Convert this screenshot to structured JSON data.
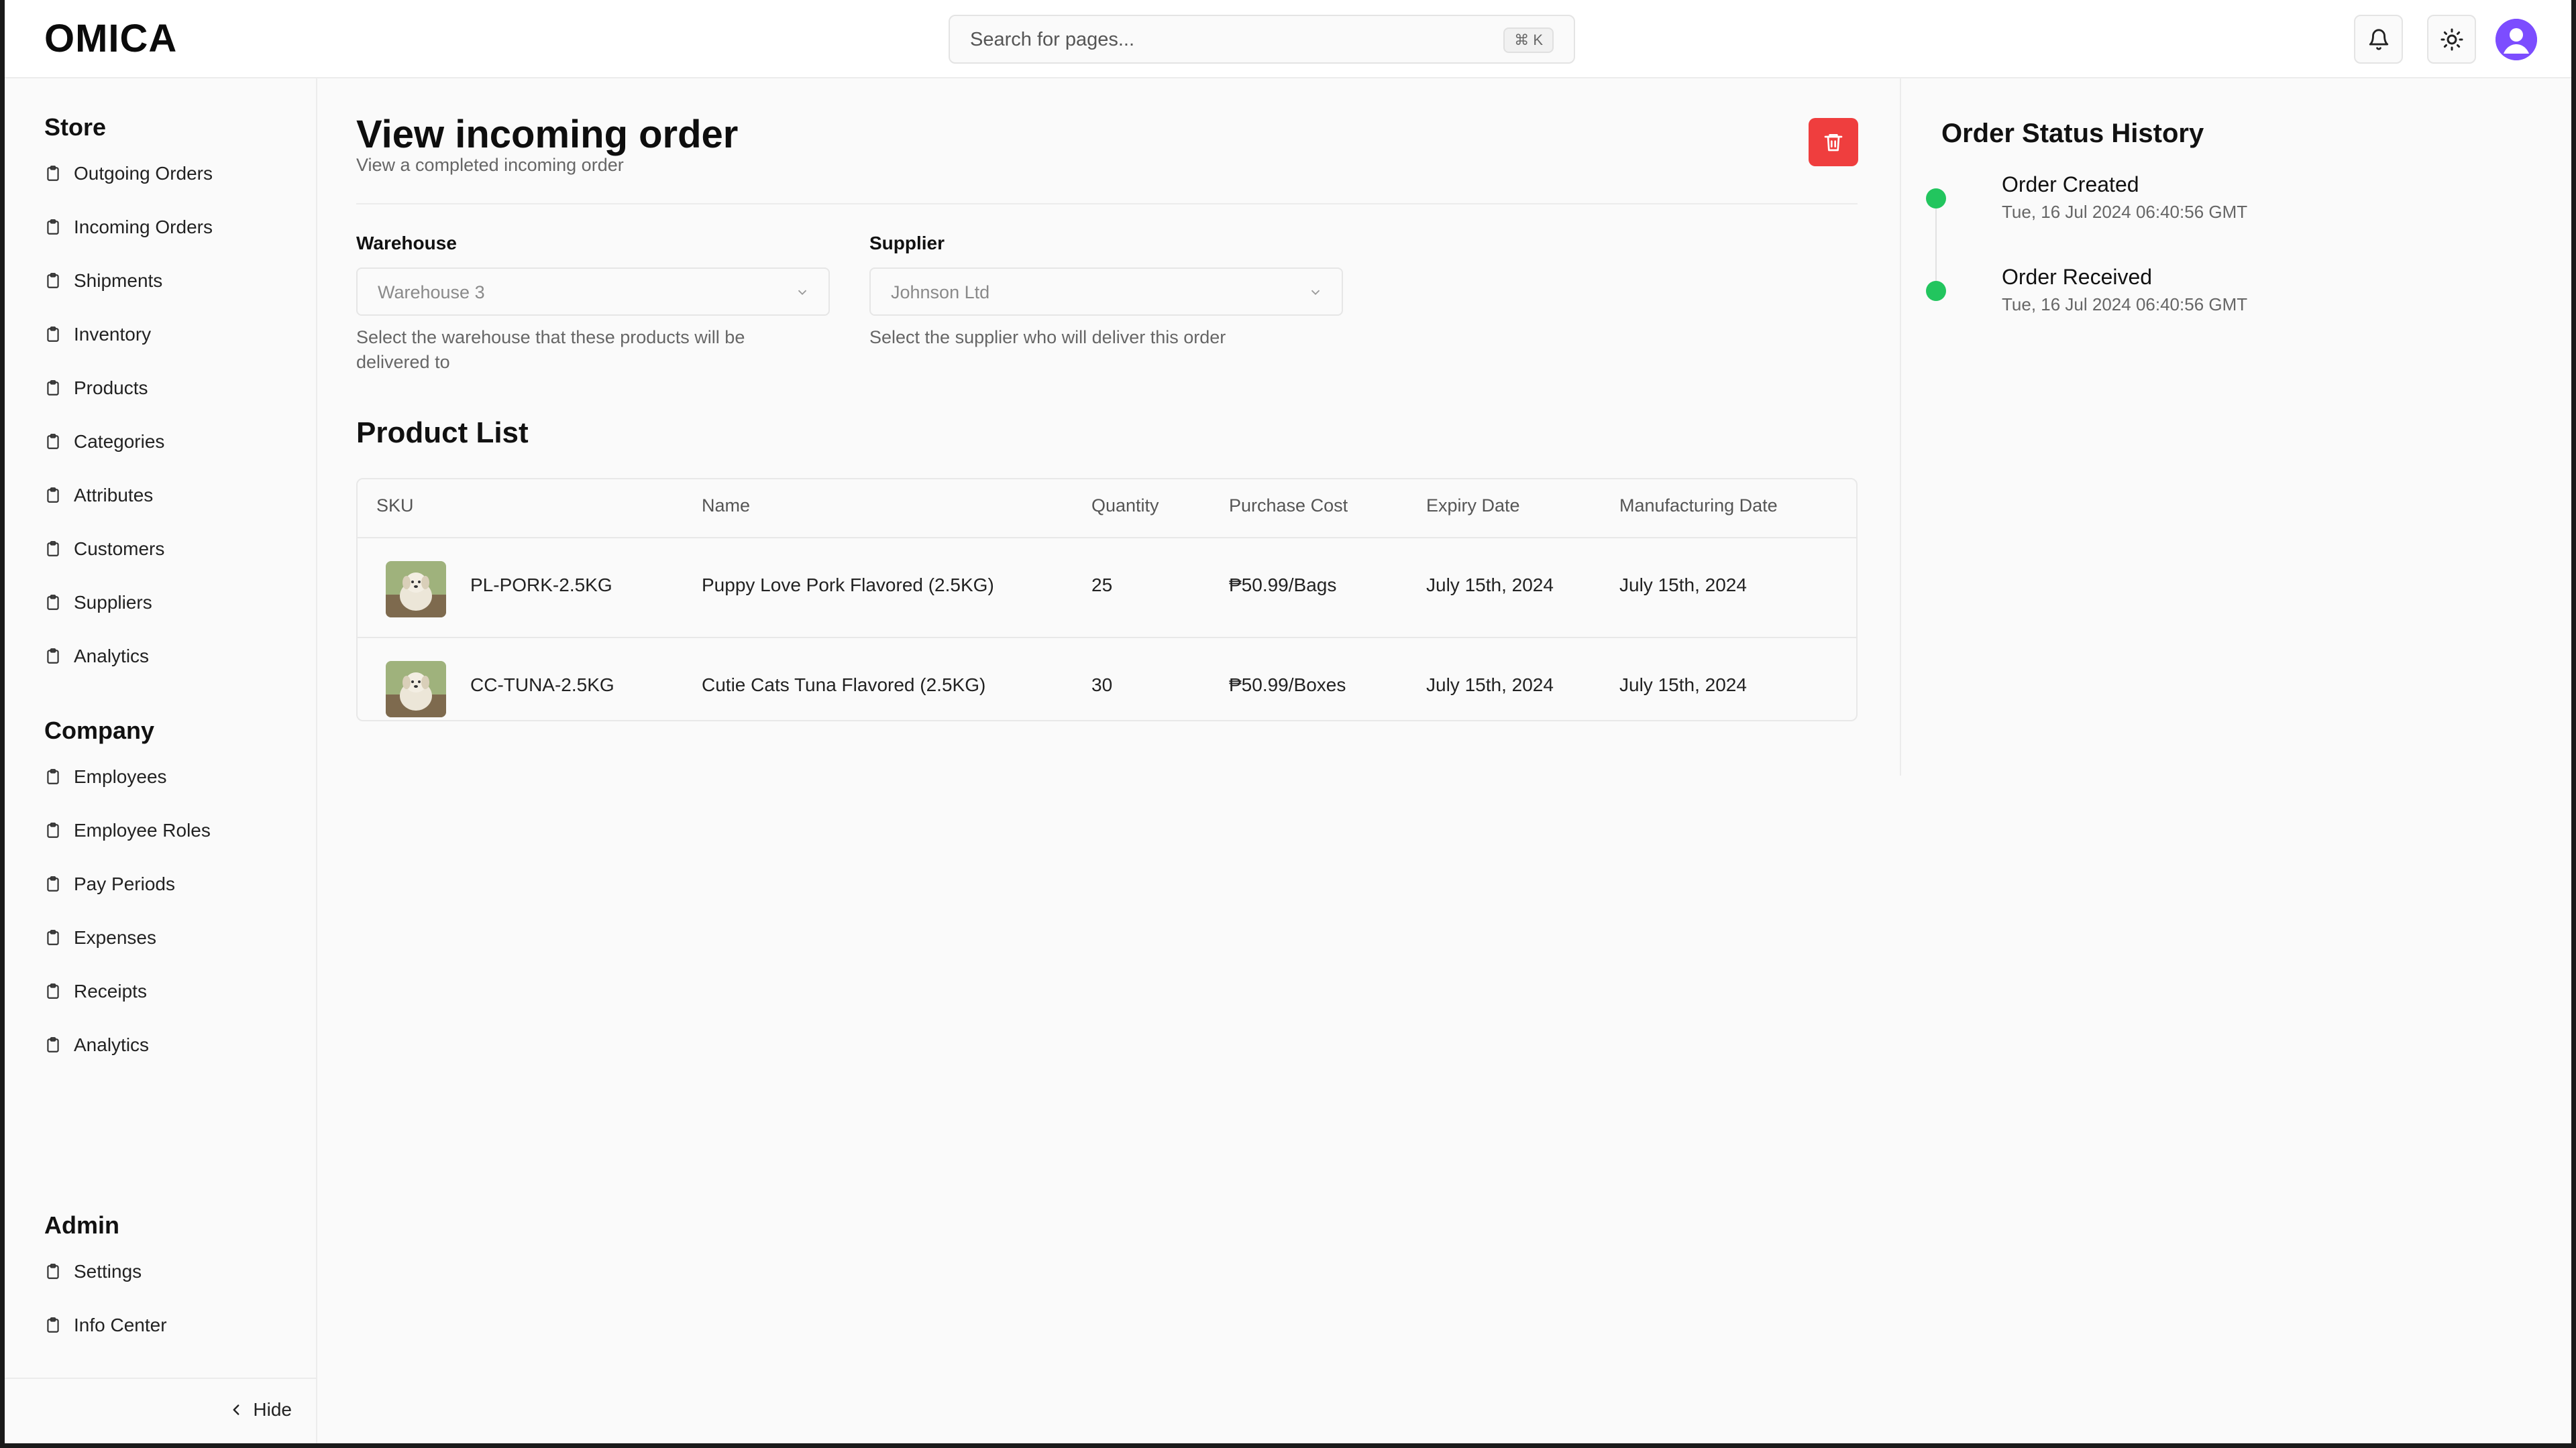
{
  "app": {
    "logo": "OMICA"
  },
  "search": {
    "placeholder": "Search for pages...",
    "shortcut": "⌘ K"
  },
  "header_icons": [
    "bell-icon",
    "sun-icon",
    "user-avatar-icon"
  ],
  "colors": {
    "accent_avatar": "#7c4dff",
    "danger": "#ef3e3e",
    "status_dot": "#22c55e"
  },
  "sidebar": {
    "sections": [
      {
        "title": "Store",
        "items": [
          "Outgoing Orders",
          "Incoming Orders",
          "Shipments",
          "Inventory",
          "Products",
          "Categories",
          "Attributes",
          "Customers",
          "Suppliers",
          "Analytics"
        ]
      },
      {
        "title": "Company",
        "items": [
          "Employees",
          "Employee Roles",
          "Pay Periods",
          "Expenses",
          "Receipts",
          "Analytics"
        ]
      },
      {
        "title": "Admin",
        "items": [
          "Settings",
          "Info Center"
        ]
      }
    ],
    "hide_label": "Hide"
  },
  "main": {
    "title": "View incoming order",
    "subtitle": "View a completed incoming order",
    "warehouse": {
      "label": "Warehouse",
      "value": "Warehouse 3",
      "help": "Select the warehouse that these products will be delivered to"
    },
    "supplier": {
      "label": "Supplier",
      "value": "Johnson Ltd",
      "help": "Select the supplier who will deliver this order"
    },
    "product_list": {
      "heading": "Product List",
      "columns": [
        "SKU",
        "Name",
        "Quantity",
        "Purchase Cost",
        "Expiry Date",
        "Manufacturing Date"
      ],
      "rows": [
        {
          "sku": "PL-PORK-2.5KG",
          "name": "Puppy Love Pork Flavored (2.5KG)",
          "quantity": "25",
          "purchase_cost": "₱50.99/Bags",
          "expiry_date": "July 15th, 2024",
          "manufacturing_date": "July 15th, 2024"
        },
        {
          "sku": "CC-TUNA-2.5KG",
          "name": "Cutie Cats Tuna Flavored (2.5KG)",
          "quantity": "30",
          "purchase_cost": "₱50.99/Boxes",
          "expiry_date": "July 15th, 2024",
          "manufacturing_date": "July 15th, 2024"
        }
      ]
    }
  },
  "status_history": {
    "title": "Order Status History",
    "entries": [
      {
        "status": "Order Created",
        "time": "Tue, 16 Jul 2024 06:40:56 GMT"
      },
      {
        "status": "Order Received",
        "time": "Tue, 16 Jul 2024 06:40:56 GMT"
      }
    ]
  }
}
